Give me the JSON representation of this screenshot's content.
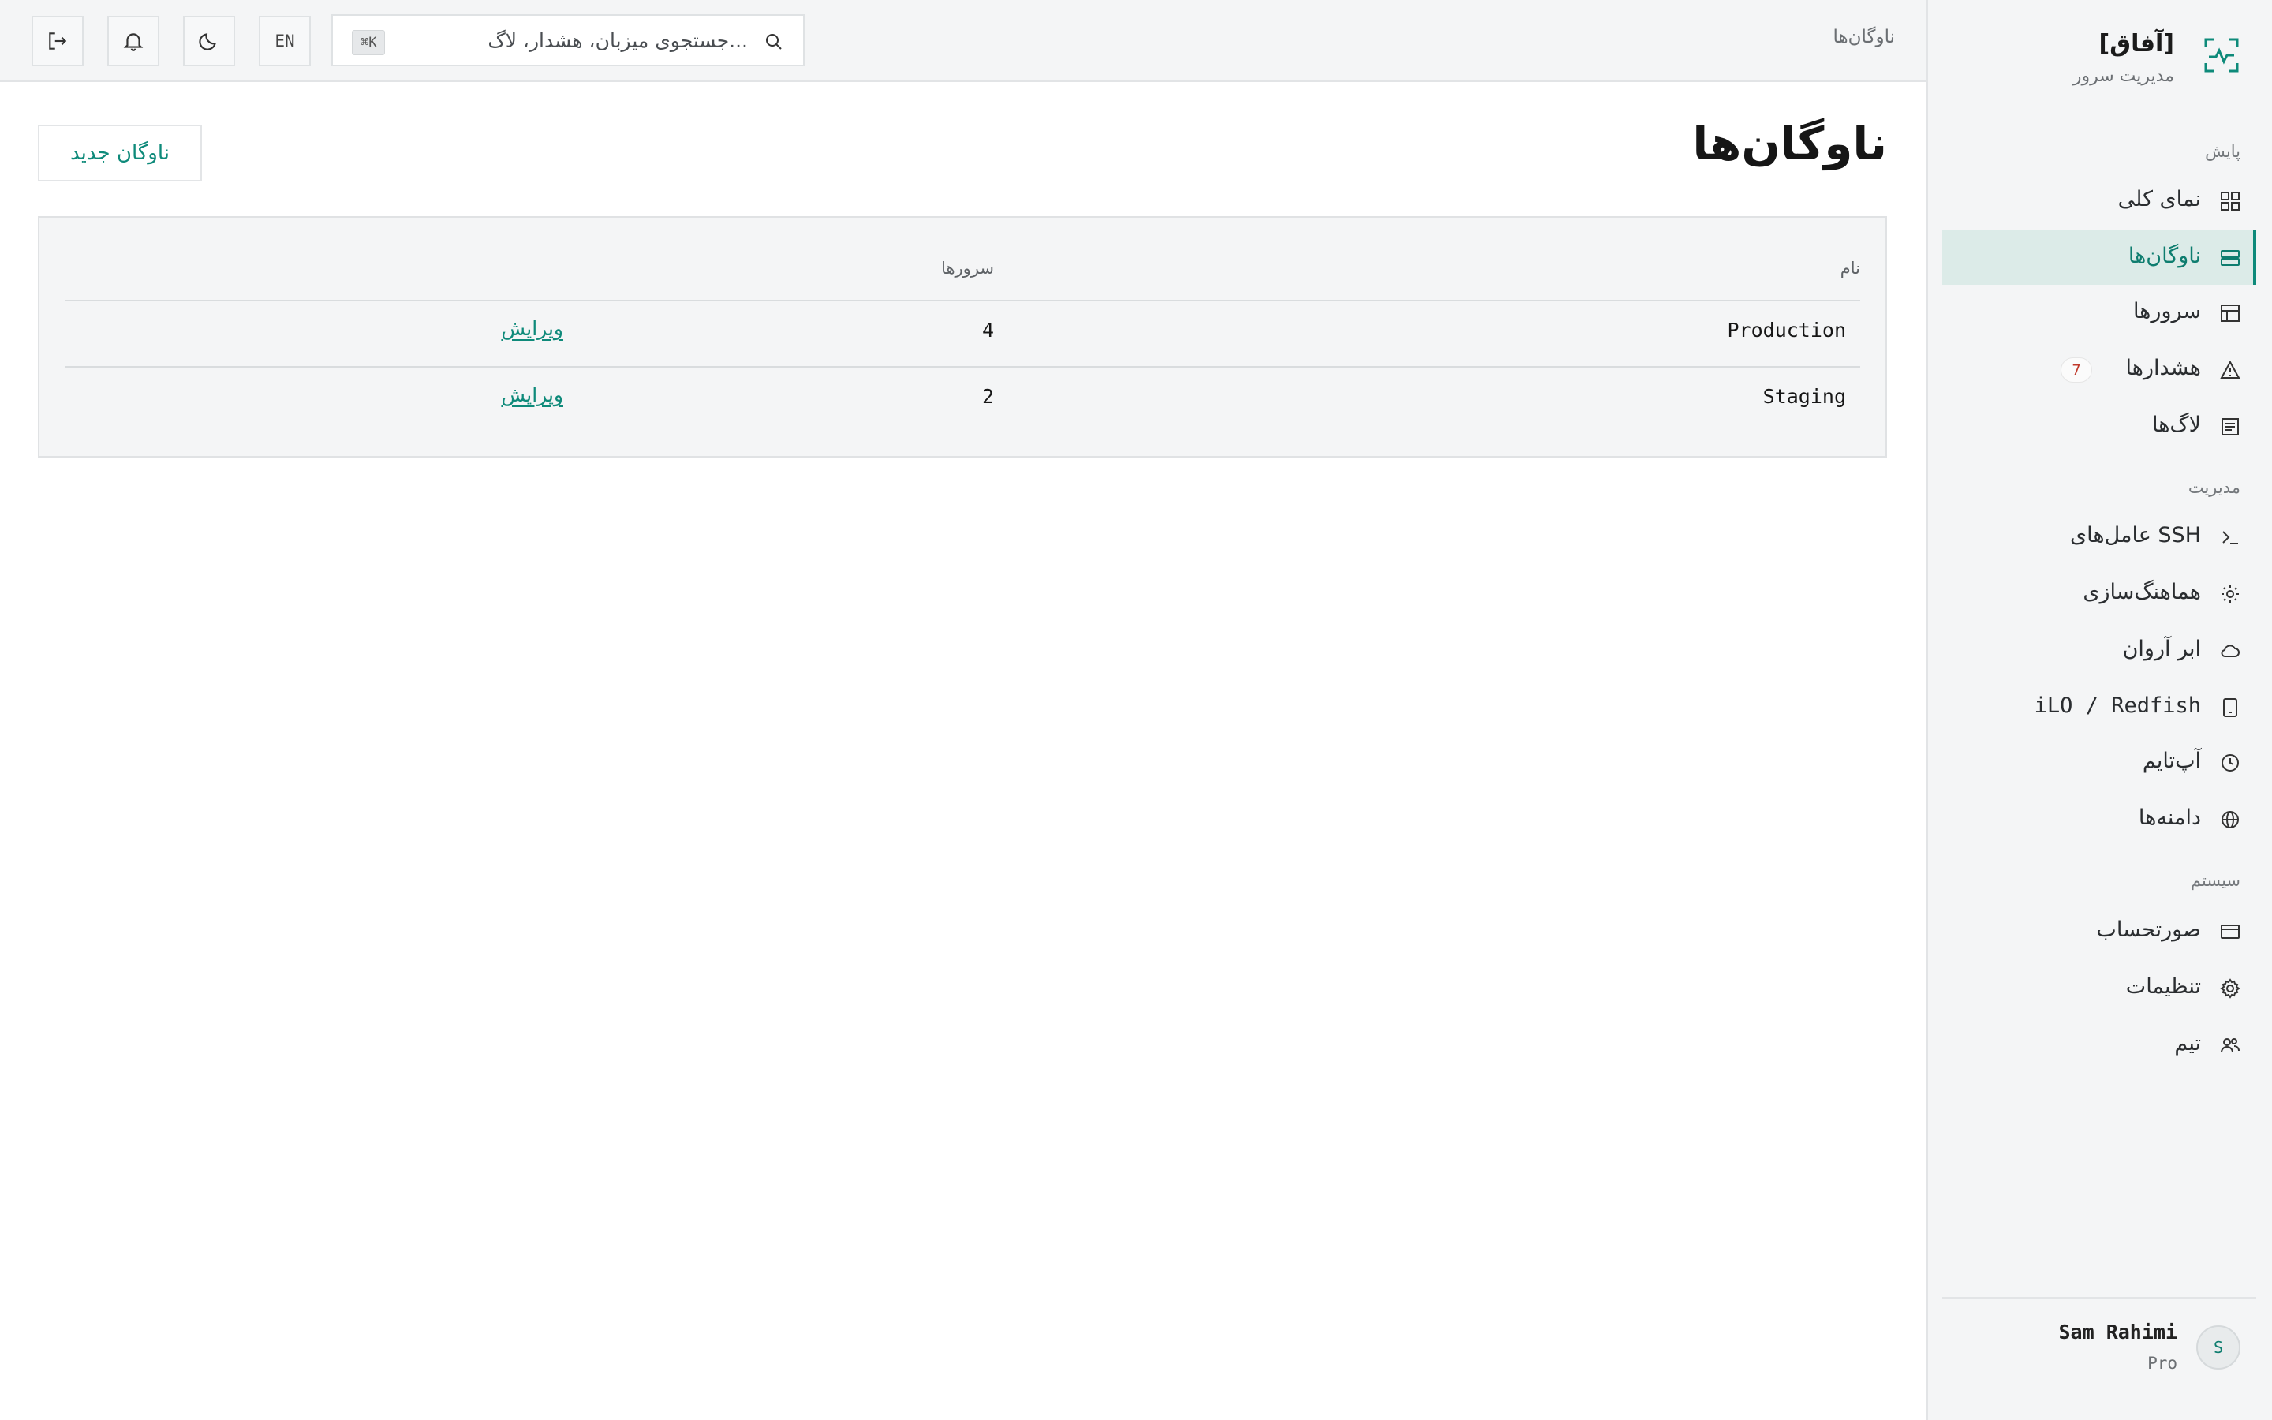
{
  "brand": {
    "name": "[آفاق]",
    "subtitle": "مدیریت سرور"
  },
  "sidebar": {
    "sections": [
      {
        "title": "پایش",
        "items": [
          {
            "label": "نمای کلی",
            "icon": "grid-icon",
            "active": false
          },
          {
            "label": "ناوگان‌ها",
            "icon": "server-stack-icon",
            "active": true
          },
          {
            "label": "سرورها",
            "icon": "table-icon",
            "active": false
          },
          {
            "label": "هشدارها",
            "icon": "warning-icon",
            "active": false,
            "badge": "7"
          },
          {
            "label": "لاگ‌ها",
            "icon": "log-icon",
            "active": false
          }
        ]
      },
      {
        "title": "مدیریت",
        "items": [
          {
            "label": "عامل‌های SSH",
            "icon": "terminal-icon",
            "active": false
          },
          {
            "label": "هماهنگ‌سازی",
            "icon": "sync-icon",
            "active": false
          },
          {
            "label": "ابر آروان",
            "icon": "cloud-icon",
            "active": false
          },
          {
            "label": "iLO / Redfish",
            "icon": "device-icon",
            "active": false
          },
          {
            "label": "آپ‌تایم",
            "icon": "clock-icon",
            "active": false
          },
          {
            "label": "دامنه‌ها",
            "icon": "globe-icon",
            "active": false
          }
        ]
      },
      {
        "title": "سیستم",
        "items": [
          {
            "label": "صورتحساب",
            "icon": "card-icon",
            "active": false
          },
          {
            "label": "تنظیمات",
            "icon": "gear-icon",
            "active": false
          },
          {
            "label": "تیم",
            "icon": "users-icon",
            "active": false
          }
        ]
      }
    ]
  },
  "user": {
    "initial": "S",
    "name": "Sam Rahimi",
    "plan": "Pro"
  },
  "topbar": {
    "breadcrumb": "ناوگان‌ها",
    "search_placeholder": "جستجوی میزبان، هشدار، لاگ...",
    "search_shortcut": "⌘K",
    "language": "EN"
  },
  "main": {
    "title": "ناوگان‌ها",
    "new_button": "ناوگان جدید",
    "table": {
      "columns": [
        "نام",
        "سرورها"
      ],
      "rows": [
        {
          "name": "Production",
          "servers": "4",
          "action": "ویرایش"
        },
        {
          "name": "Staging",
          "servers": "2",
          "action": "ویرایش"
        }
      ]
    }
  },
  "colors": {
    "accent": "#0e8a7a",
    "active_bg": "#dcebe8",
    "badge_text": "#c0392b"
  }
}
